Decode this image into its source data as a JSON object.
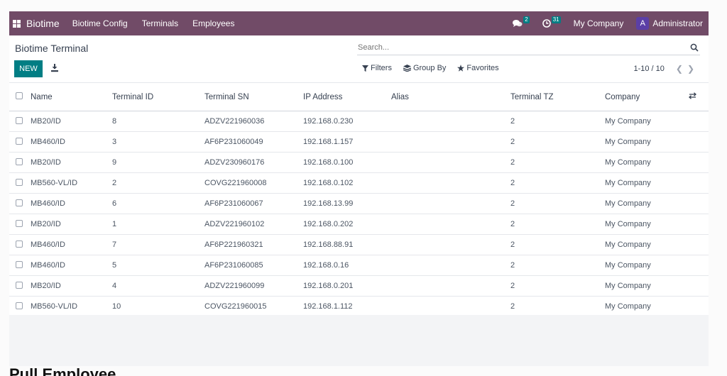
{
  "navbar": {
    "app_name": "Biotime",
    "menu": [
      "Biotime Config",
      "Terminals",
      "Employees"
    ],
    "messages_badge": "2",
    "activities_badge": "31",
    "company": "My Company",
    "avatar_letter": "A",
    "user": "Administrator",
    "bg_color": "#714b67"
  },
  "control": {
    "title": "Biotime Terminal",
    "new_label": "NEW",
    "search_placeholder": "Search...",
    "filters_label": "Filters",
    "groupby_label": "Group By",
    "favorites_label": "Favorites",
    "pager": "1-10 / 10",
    "accent": "#017e84"
  },
  "table": {
    "columns": [
      "Name",
      "Terminal ID",
      "Terminal SN",
      "IP Address",
      "Alias",
      "Terminal TZ",
      "Company"
    ],
    "rows": [
      [
        "MB20/ID",
        "8",
        "ADZV221960036",
        "192.168.0.230",
        "",
        "2",
        "My Company"
      ],
      [
        "MB460/ID",
        "3",
        "AF6P231060049",
        "192.168.1.157",
        "",
        "2",
        "My Company"
      ],
      [
        "MB20/ID",
        "9",
        "ADZV230960176",
        "192.168.0.100",
        "",
        "2",
        "My Company"
      ],
      [
        "MB560-VL/ID",
        "2",
        "COVG221960008",
        "192.168.0.102",
        "",
        "2",
        "My Company"
      ],
      [
        "MB460/ID",
        "6",
        "AF6P231060067",
        "192.168.13.99",
        "",
        "2",
        "My Company"
      ],
      [
        "MB20/ID",
        "1",
        "ADZV221960102",
        "192.168.0.202",
        "",
        "2",
        "My Company"
      ],
      [
        "MB460/ID",
        "7",
        "AF6P221960321",
        "192.168.88.91",
        "",
        "2",
        "My Company"
      ],
      [
        "MB460/ID",
        "5",
        "AF6P231060085",
        "192.168.0.16",
        "",
        "2",
        "My Company"
      ],
      [
        "MB20/ID",
        "4",
        "ADZV221960099",
        "192.168.0.201",
        "",
        "2",
        "My Company"
      ],
      [
        "MB560-VL/ID",
        "10",
        "COVG221960015",
        "192.168.1.112",
        "",
        "2",
        "My Company"
      ]
    ]
  },
  "footer": {
    "partial_heading": "Pull Employee"
  }
}
